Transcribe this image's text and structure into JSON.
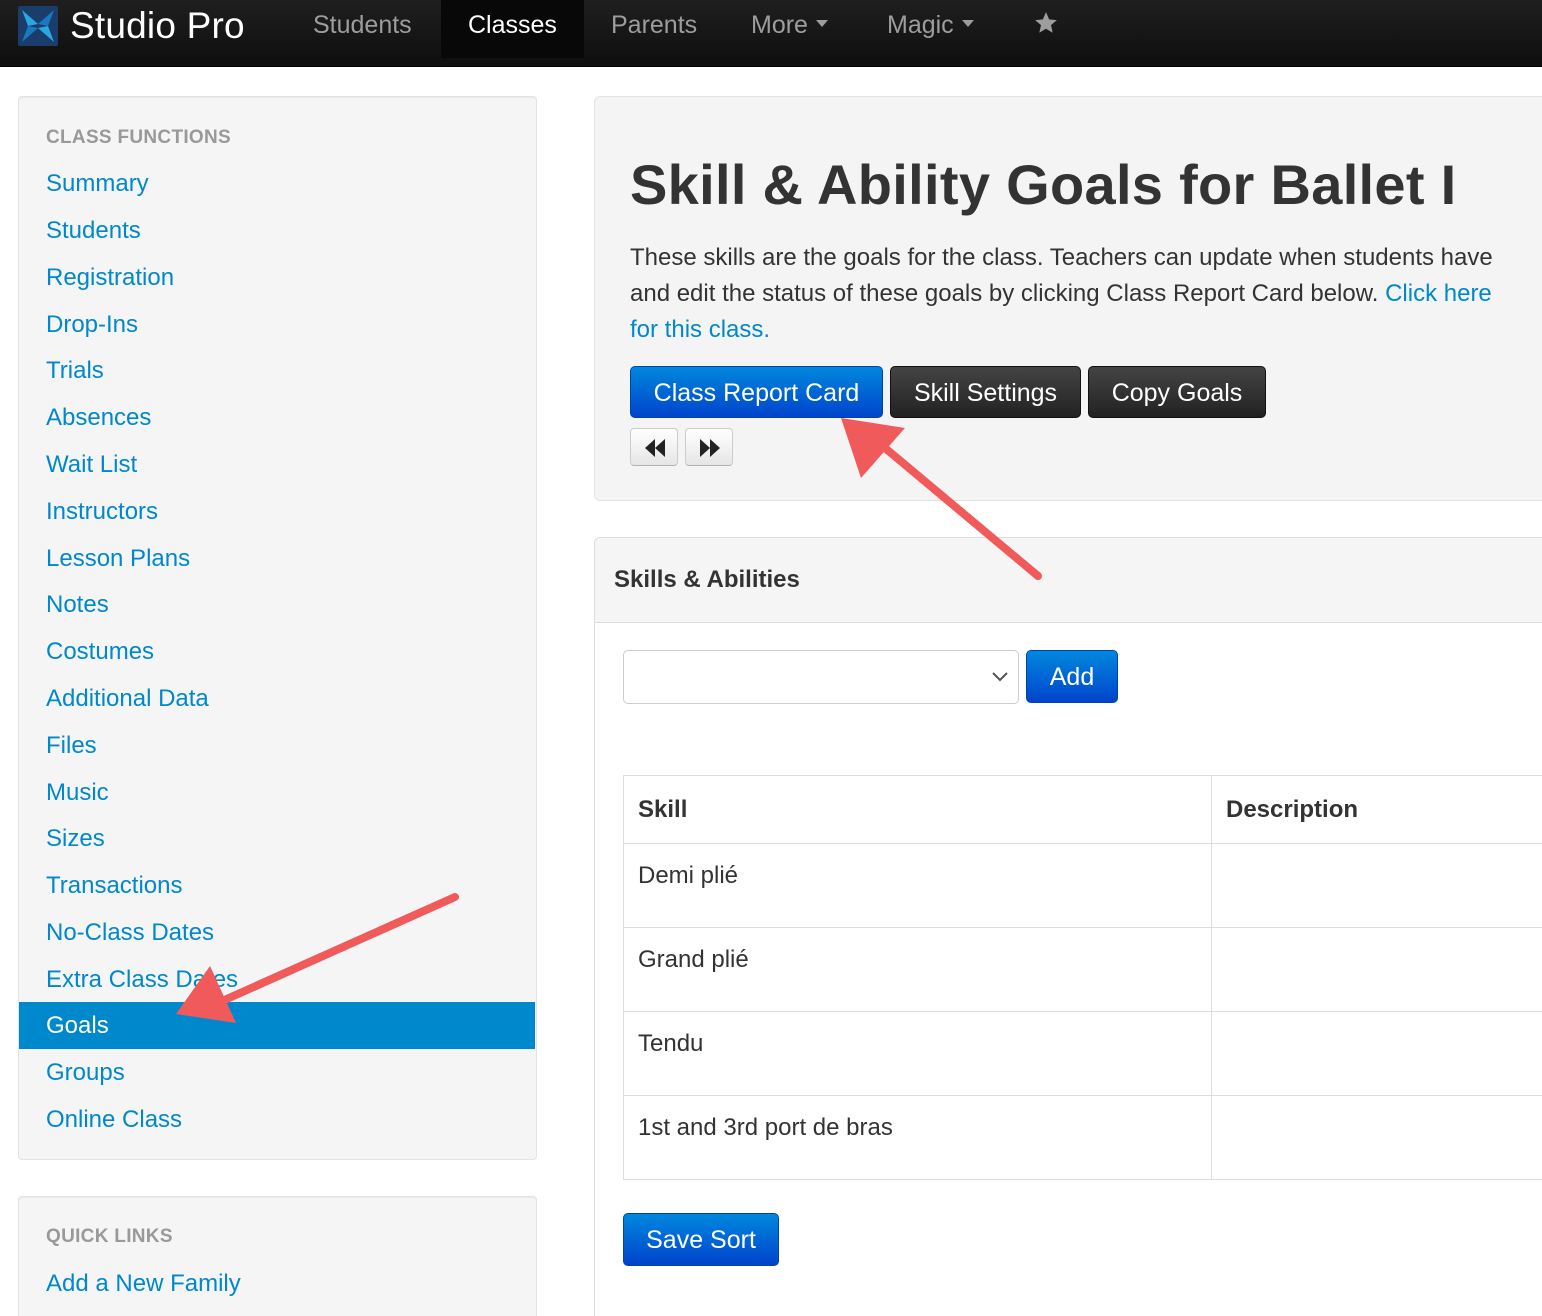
{
  "navbar": {
    "brand": "Studio Pro",
    "items": [
      {
        "label": "Students"
      },
      {
        "label": "Classes"
      },
      {
        "label": "Parents"
      },
      {
        "label": "More"
      },
      {
        "label": "Magic"
      }
    ],
    "star_icon": "star-icon"
  },
  "sidebar": {
    "class_functions_header": "CLASS FUNCTIONS",
    "items": [
      {
        "label": "Summary"
      },
      {
        "label": "Students"
      },
      {
        "label": "Registration"
      },
      {
        "label": "Drop-Ins"
      },
      {
        "label": "Trials"
      },
      {
        "label": "Absences"
      },
      {
        "label": "Wait List"
      },
      {
        "label": "Instructors"
      },
      {
        "label": "Lesson Plans"
      },
      {
        "label": "Notes"
      },
      {
        "label": "Costumes"
      },
      {
        "label": "Additional Data"
      },
      {
        "label": "Files"
      },
      {
        "label": "Music"
      },
      {
        "label": "Sizes"
      },
      {
        "label": "Transactions"
      },
      {
        "label": "No-Class Dates"
      },
      {
        "label": "Extra Class Dates"
      },
      {
        "label": "Goals"
      },
      {
        "label": "Groups"
      },
      {
        "label": "Online Class"
      }
    ],
    "active_item": "Goals",
    "quick_links_header": "QUICK LINKS",
    "quick_links": [
      {
        "label": "Add a New Family"
      }
    ]
  },
  "hero": {
    "title": "Skill & Ability Goals for Ballet I",
    "text_line1": "These skills are the goals for the class. Teachers can update when students have",
    "text_line2_pre": "and edit the status of these goals by clicking Class Report Card below. ",
    "text_line2_link": "Click here",
    "text_line3_link": "for this class.",
    "buttons": {
      "report_card": "Class Report Card",
      "skill_settings": "Skill Settings",
      "copy_goals": "Copy Goals"
    },
    "nav_icons": [
      "backward-icon",
      "forward-icon"
    ]
  },
  "skills_panel": {
    "title": "Skills & Abilities",
    "select_value": "",
    "add_label": "Add",
    "columns": [
      "Skill",
      "Description"
    ],
    "rows": [
      {
        "skill": "Demi plié",
        "description": ""
      },
      {
        "skill": "Grand plié",
        "description": ""
      },
      {
        "skill": "Tendu",
        "description": ""
      },
      {
        "skill": "1st and 3rd port de bras",
        "description": ""
      }
    ],
    "save_sort_label": "Save Sort"
  },
  "colors": {
    "link": "#0088cc",
    "primary": "#0055cc",
    "annotation_arrow": "#f05a5a",
    "navbar": "#151515"
  }
}
